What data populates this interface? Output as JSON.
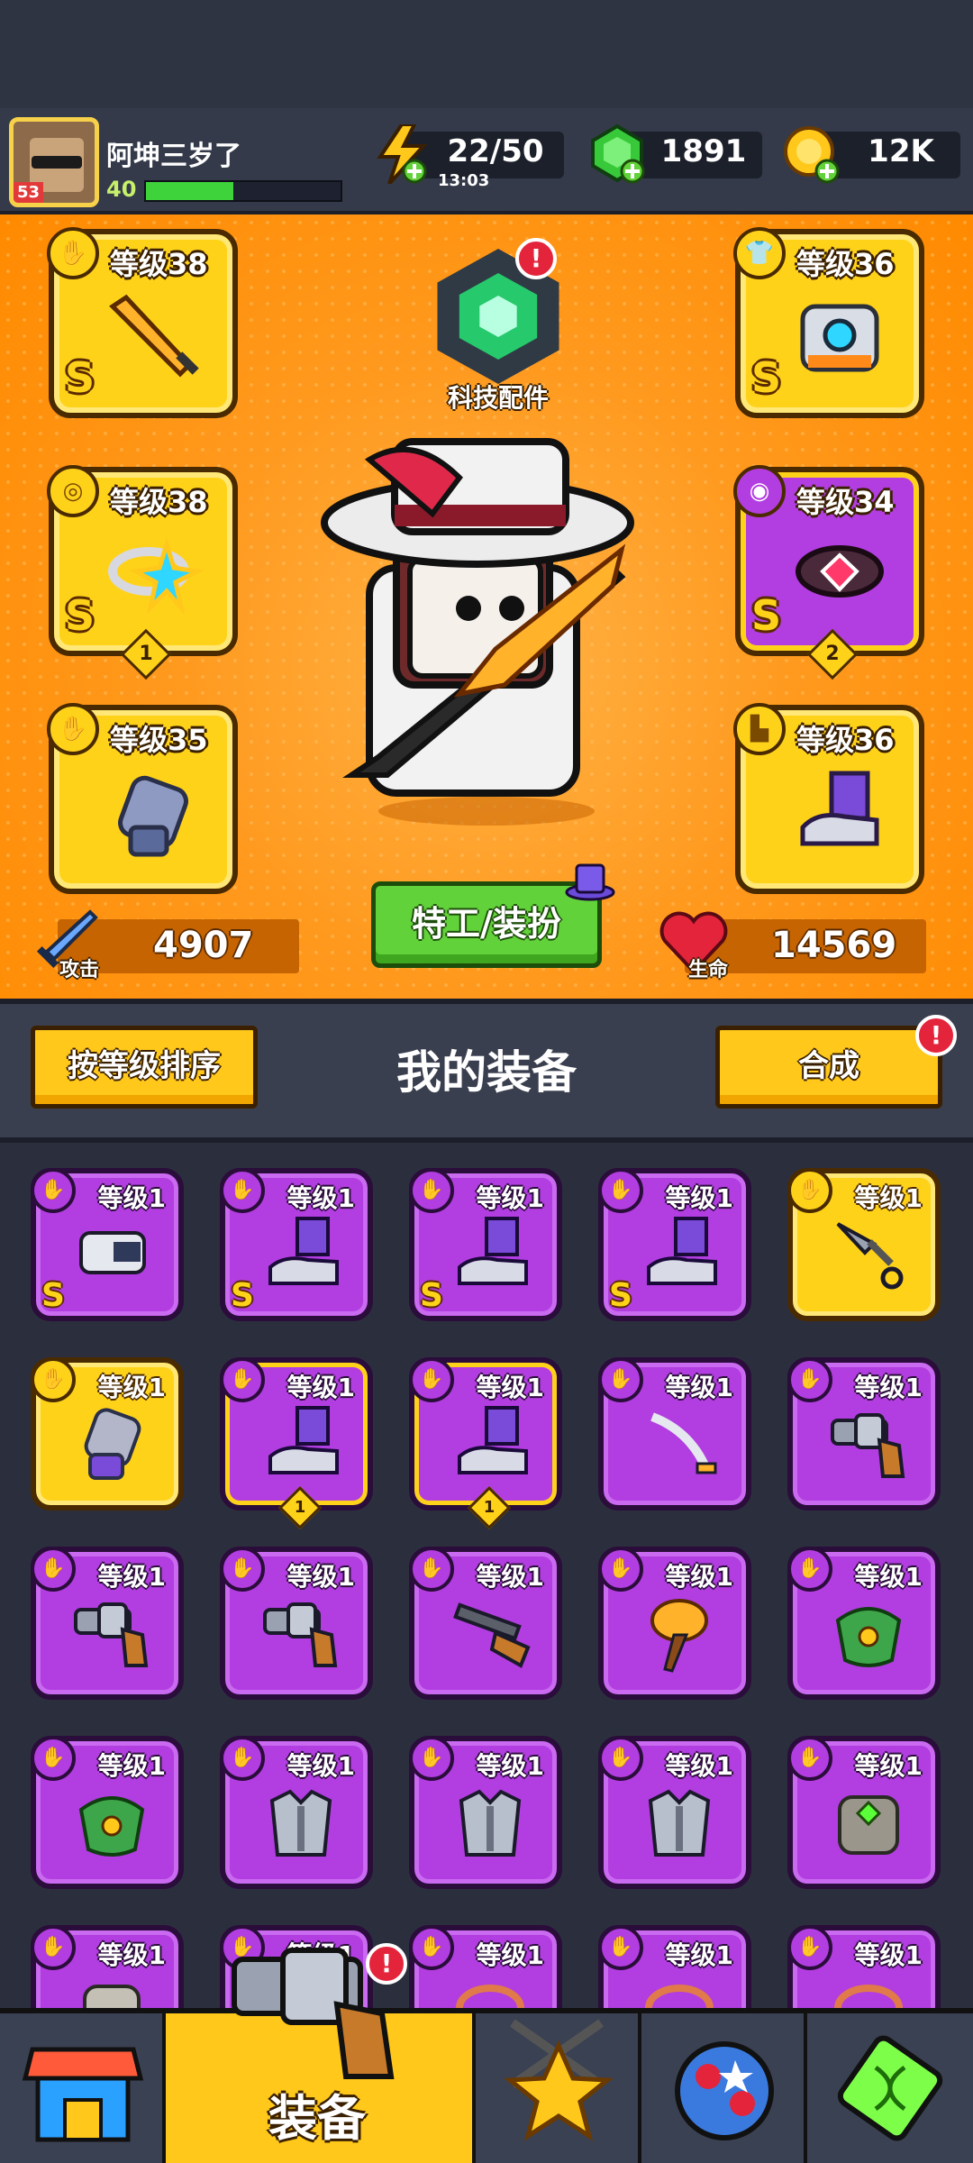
{
  "player": {
    "name": "阿坤三岁了",
    "level": "40",
    "avatar_badge": "53",
    "xp_fraction": 0.45
  },
  "resources": {
    "energy": "22/50",
    "energy_timer": "13:03",
    "gems": "1891",
    "coins": "12K"
  },
  "hero_panel": {
    "tech_parts_label": "科技配件",
    "tech_alert": "!",
    "agent_button": "特工/装扮",
    "attack_label": "攻击",
    "attack_value": "4907",
    "hp_label": "生命",
    "hp_value": "14569",
    "slots": [
      {
        "id": "weapon",
        "level": "等级38",
        "grade": "S",
        "color": "gold",
        "icon": "weapon-icon",
        "stars": ""
      },
      {
        "id": "armor",
        "level": "等级36",
        "grade": "S",
        "color": "gold",
        "icon": "armor-icon",
        "stars": ""
      },
      {
        "id": "necklace",
        "level": "等级38",
        "grade": "S",
        "color": "gold",
        "icon": "necklace-icon",
        "stars": "1"
      },
      {
        "id": "belt",
        "level": "等级34",
        "grade": "S",
        "color": "purple",
        "icon": "belt-icon",
        "stars": "2"
      },
      {
        "id": "gloves",
        "level": "等级35",
        "grade": "",
        "color": "gold",
        "icon": "glove-icon",
        "stars": ""
      },
      {
        "id": "boots",
        "level": "等级36",
        "grade": "",
        "color": "gold",
        "icon": "boots-icon",
        "stars": ""
      }
    ]
  },
  "equipment_header": {
    "sort_button": "按等级排序",
    "title": "我的装备",
    "merge_button": "合成",
    "merge_alert": "!"
  },
  "inventory": [
    {
      "level": "等级1",
      "grade": "S",
      "color": "purple",
      "icon": "visor-icon",
      "stars": ""
    },
    {
      "level": "等级1",
      "grade": "S",
      "color": "purple",
      "icon": "boots-icon",
      "stars": ""
    },
    {
      "level": "等级1",
      "grade": "S",
      "color": "purple",
      "icon": "boots-icon",
      "stars": ""
    },
    {
      "level": "等级1",
      "grade": "S",
      "color": "purple",
      "icon": "boots-icon",
      "stars": ""
    },
    {
      "level": "等级1",
      "grade": "",
      "color": "gold",
      "icon": "kunai-icon",
      "stars": ""
    },
    {
      "level": "等级1",
      "grade": "",
      "color": "gold",
      "icon": "glove-icon",
      "stars": ""
    },
    {
      "level": "等级1",
      "grade": "",
      "color": "ring",
      "icon": "boots-icon",
      "stars": "1"
    },
    {
      "level": "等级1",
      "grade": "",
      "color": "ring",
      "icon": "boots-icon",
      "stars": "1"
    },
    {
      "level": "等级1",
      "grade": "",
      "color": "purple",
      "icon": "saber-icon",
      "stars": ""
    },
    {
      "level": "等级1",
      "grade": "",
      "color": "purple",
      "icon": "revolver-icon",
      "stars": ""
    },
    {
      "level": "等级1",
      "grade": "",
      "color": "purple",
      "icon": "revolver-icon",
      "stars": ""
    },
    {
      "level": "等级1",
      "grade": "",
      "color": "purple",
      "icon": "revolver-icon",
      "stars": ""
    },
    {
      "level": "等级1",
      "grade": "",
      "color": "purple",
      "icon": "shotgun-icon",
      "stars": ""
    },
    {
      "level": "等级1",
      "grade": "",
      "color": "purple",
      "icon": "torch-icon",
      "stars": ""
    },
    {
      "level": "等级1",
      "grade": "",
      "color": "purple",
      "icon": "leaf-armor-icon",
      "stars": ""
    },
    {
      "level": "等级1",
      "grade": "",
      "color": "purple",
      "icon": "leaf-armor-icon",
      "stars": ""
    },
    {
      "level": "等级1",
      "grade": "",
      "color": "purple",
      "icon": "steel-armor-icon",
      "stars": ""
    },
    {
      "level": "等级1",
      "grade": "",
      "color": "purple",
      "icon": "steel-armor-icon",
      "stars": ""
    },
    {
      "level": "等级1",
      "grade": "",
      "color": "purple",
      "icon": "steel-armor-icon",
      "stars": ""
    },
    {
      "level": "等级1",
      "grade": "",
      "color": "purple",
      "icon": "stone-armor-icon",
      "stars": ""
    },
    {
      "level": "等级1",
      "grade": "",
      "color": "purple",
      "icon": "armor-icon",
      "stars": ""
    },
    {
      "level": "等级1",
      "grade": "",
      "color": "purple",
      "icon": "armor-icon",
      "stars": ""
    },
    {
      "level": "等级1",
      "grade": "",
      "color": "purple",
      "icon": "necklace-icon",
      "stars": ""
    },
    {
      "level": "等级1",
      "grade": "",
      "color": "purple",
      "icon": "necklace-icon",
      "stars": ""
    },
    {
      "level": "等级1",
      "grade": "",
      "color": "purple",
      "icon": "necklace-icon",
      "stars": ""
    }
  ],
  "bottom_nav": {
    "shop": "shop-icon",
    "equipment_label": "装备",
    "equipment_alert": "!",
    "battle": "battle-icon",
    "talent": "talent-icon",
    "evolve": "dna-icon"
  },
  "colors": {
    "gold": "#ffd21a",
    "purple": "#b23de0",
    "orange_bg": "#ff9a1f",
    "green_button": "#62d23a",
    "alert_red": "#e3243b"
  }
}
